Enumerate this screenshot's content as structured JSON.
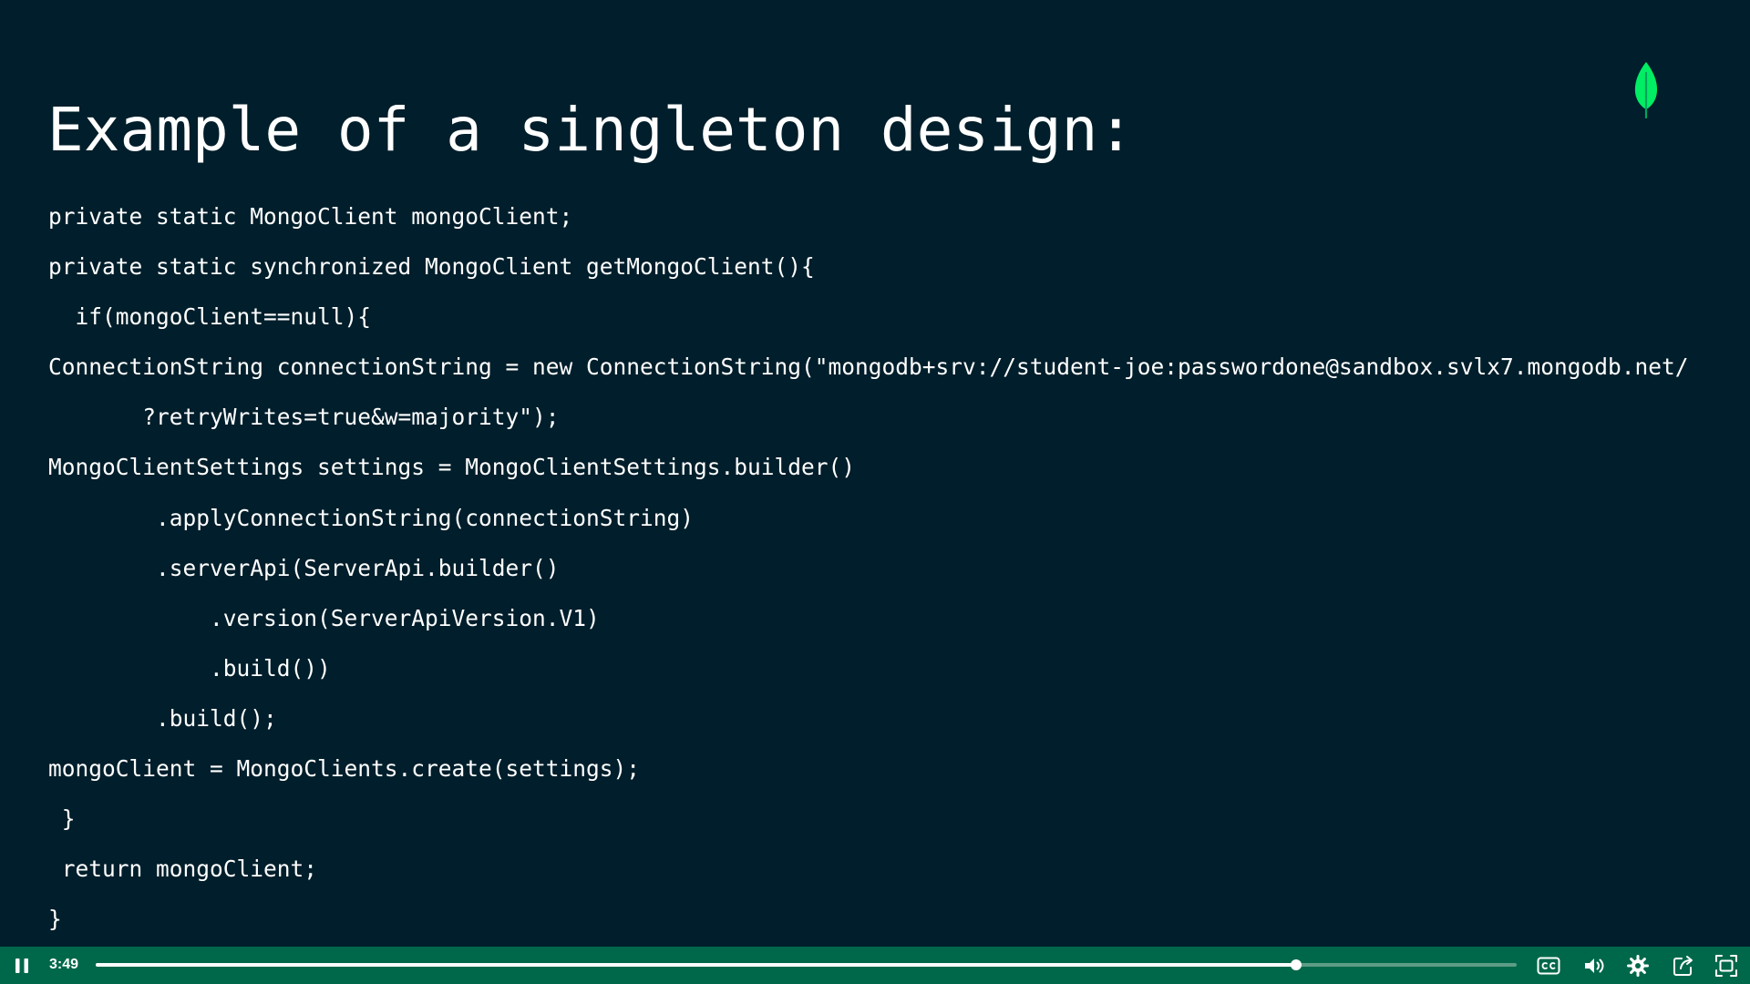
{
  "slide": {
    "title": "Example of a singleton design:",
    "logo_icon": "mongodb-leaf-icon",
    "code_lines": [
      "private static MongoClient mongoClient;",
      "private static synchronized MongoClient getMongoClient(){",
      "  if(mongoClient==null){",
      "ConnectionString connectionString = new ConnectionString(\"mongodb+srv://student-joe:passwordone@sandbox.svlx7.mongodb.net/",
      "       ?retryWrites=true&w=majority\");",
      "MongoClientSettings settings = MongoClientSettings.builder()",
      "        .applyConnectionString(connectionString)",
      "        .serverApi(ServerApi.builder()",
      "            .version(ServerApiVersion.V1)",
      "            .build())",
      "        .build();",
      "mongoClient = MongoClients.create(settings);",
      " }",
      " return mongoClient;",
      "}"
    ]
  },
  "player": {
    "time": "3:49",
    "progress_fraction": 0.845,
    "icons": {
      "play": "pause-icon",
      "captions": "closed-captions-icon",
      "volume": "volume-icon",
      "settings": "settings-gear-icon",
      "popout": "open-external-icon",
      "fullscreen": "fullscreen-icon"
    }
  },
  "colors": {
    "background": "#001e2b",
    "text": "#ffffff",
    "controls_bar": "#00684a",
    "leaf": "#00ed64"
  }
}
